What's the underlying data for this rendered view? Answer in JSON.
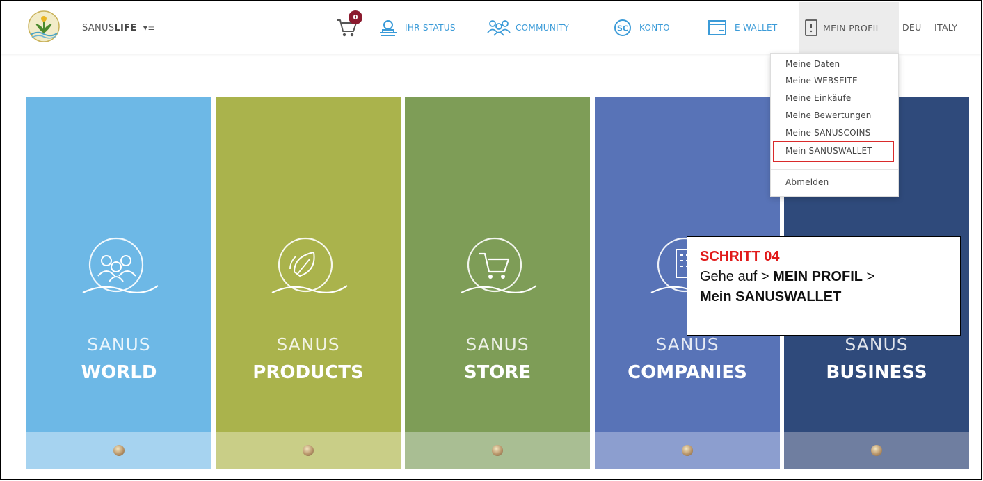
{
  "header": {
    "brand_prefix": "SANUS",
    "brand_bold": "LIFE",
    "brand_menu_glyph": "≡",
    "cart_count": "0",
    "nav": [
      {
        "label": "IHR STATUS",
        "icon": "crown-icon"
      },
      {
        "label": "COMMUNITY",
        "icon": "people-icon"
      },
      {
        "label": "KONTO",
        "icon": "sc-coin-icon"
      },
      {
        "label": "E-WALLET",
        "icon": "wallet-icon"
      }
    ],
    "profile_label": "MEIN PROFIL",
    "languages": [
      "DEU",
      "ITALY"
    ]
  },
  "dropdown": {
    "items": [
      "Meine Daten",
      "Meine WEBSEITE",
      "Meine Einkäufe",
      "Meine Bewertungen",
      "Meine SANUSCOINS",
      "Mein SANUSWALLET"
    ],
    "highlighted_index": 5,
    "logout": "Abmelden"
  },
  "columns": [
    {
      "prefix": "SANUS",
      "word": "WORLD",
      "color": "#6db8e6",
      "foot": "#a6d3f0",
      "icon": "community-icon"
    },
    {
      "prefix": "SANUS",
      "word": "PRODUCTS",
      "color": "#aab34c",
      "foot": "#c9ce87",
      "icon": "leaf-drop-icon"
    },
    {
      "prefix": "SANUS",
      "word": "STORE",
      "color": "#7e9d57",
      "foot": "#a9be93",
      "icon": "cart-icon"
    },
    {
      "prefix": "SANUS",
      "word": "COMPANIES",
      "color": "#5873b7",
      "foot": "#8c9ecf",
      "icon": "building-icon"
    },
    {
      "prefix": "SANUS",
      "word": "BUSINESS",
      "color": "#2f4a7b",
      "foot": "#6f7ea0",
      "icon": "business-icon"
    }
  ],
  "callout": {
    "step": "SCHRITT 04",
    "text_prefix": "Gehe auf >",
    "bold_1": "MEIN PROFIL",
    "separator": ">",
    "bold_2": "Mein SANUSWALLET"
  }
}
